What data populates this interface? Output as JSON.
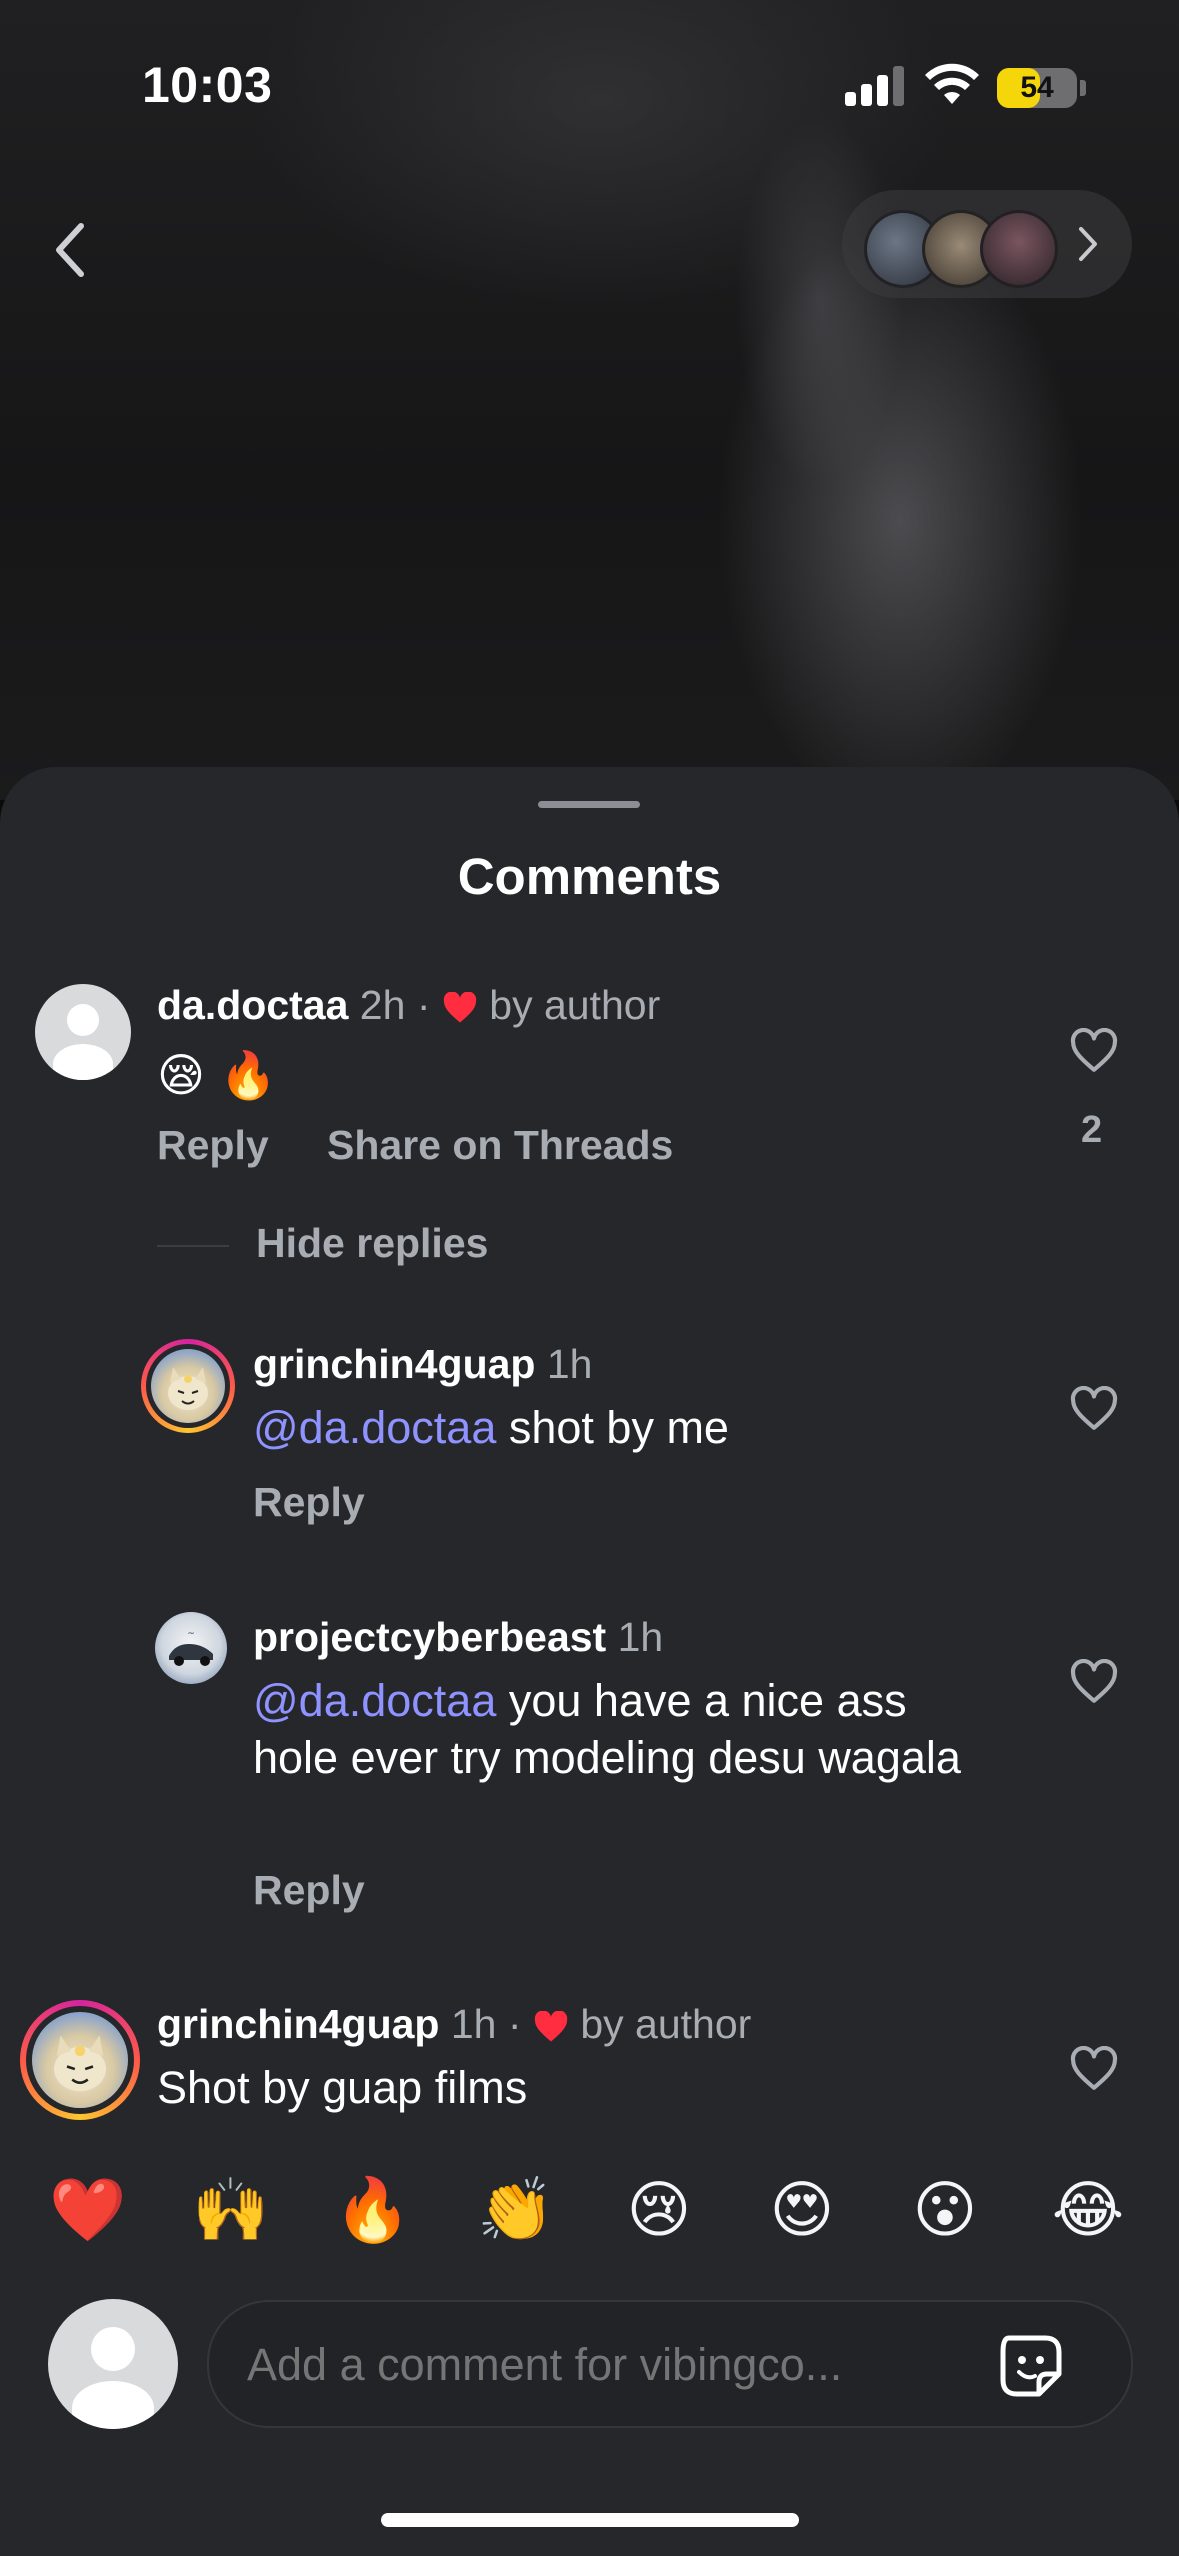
{
  "status_bar": {
    "time": "10:03",
    "battery_level": "54",
    "battery_fraction": 0.54,
    "signal_bars_active": 3,
    "icons": [
      "signal-icon",
      "wifi-icon",
      "battery-icon"
    ]
  },
  "top_nav": {
    "back_icon": "chevron-left-icon",
    "stories_chevron_icon": "chevron-right-icon",
    "story_thumbnails": 3
  },
  "sheet": {
    "title": "Comments"
  },
  "comments": [
    {
      "username": "da.doctaa",
      "time": "2h",
      "separator": "·",
      "liked_by_author_label": "by author",
      "text": "😪 🔥",
      "reply_label": "Reply",
      "share_label": "Share on Threads",
      "like_count": "2",
      "hide_replies_label": "Hide replies",
      "replies": [
        {
          "username": "grinchin4guap",
          "time": "1h",
          "mention": "@da.doctaa",
          "text": " shot by me",
          "reply_label": "Reply"
        },
        {
          "username": "projectcyberbeast",
          "time": "1h",
          "mention": "@da.doctaa",
          "text": " you have a nice ass hole ever try modeling desu wagala",
          "reply_label": "Reply"
        }
      ]
    },
    {
      "username": "grinchin4guap",
      "time": "1h",
      "separator": "·",
      "liked_by_author_label": "by author",
      "text": "Shot by guap films"
    }
  ],
  "emoji_bar": [
    "❤️",
    "🙌",
    "🔥",
    "👏",
    "😢",
    "😍",
    "😮",
    "😂"
  ],
  "composer": {
    "placeholder": "Add a comment for vibingco...",
    "sticker_icon": "sticker-icon"
  },
  "colors": {
    "sheet_background": "#26272b",
    "mention": "#8f93ff",
    "muted_text": "#a8acb3",
    "liked_heart": "#ff2d3f",
    "battery_fill": "#f5d60a"
  }
}
